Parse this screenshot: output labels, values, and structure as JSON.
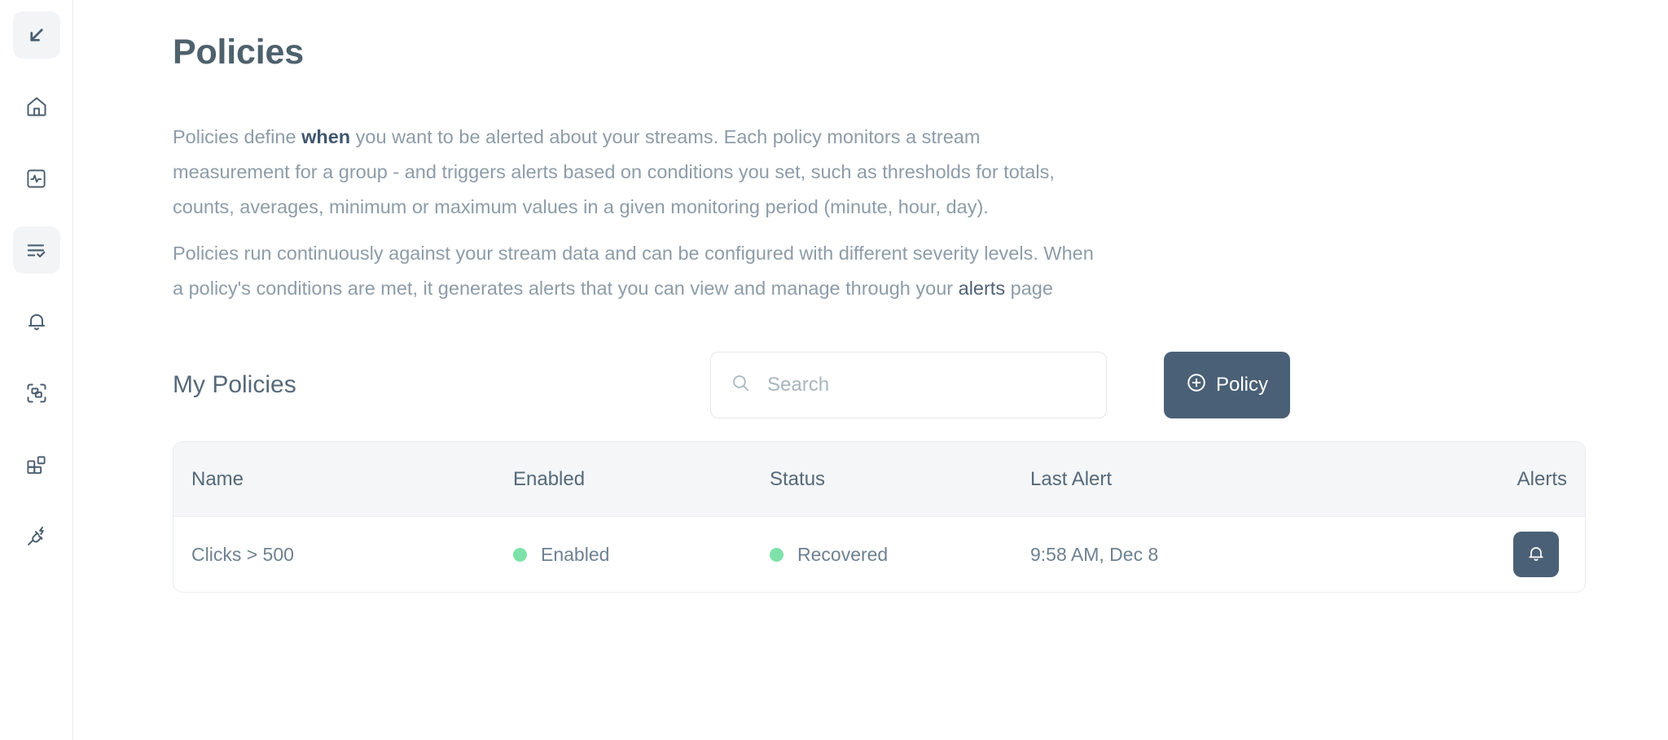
{
  "sidebar": {
    "items": [
      {
        "name": "collapse-sidebar",
        "icon": "collapse-arrow-icon",
        "active": true
      },
      {
        "name": "home",
        "icon": "home-icon",
        "active": false
      },
      {
        "name": "streams",
        "icon": "activity-pulse-icon",
        "active": false
      },
      {
        "name": "policies",
        "icon": "list-check-icon",
        "active": true
      },
      {
        "name": "alerts",
        "icon": "bell-icon",
        "active": false
      },
      {
        "name": "groups",
        "icon": "scan-group-icon",
        "active": false
      },
      {
        "name": "dashboards",
        "icon": "blocks-icon",
        "active": false
      },
      {
        "name": "integrations",
        "icon": "plug-zap-icon",
        "active": false
      }
    ]
  },
  "page": {
    "title": "Policies",
    "paragraph1_pre": "Policies define ",
    "paragraph1_strong": "when",
    "paragraph1_post": " you want to be alerted about your streams. Each policy monitors a stream measurement for a group - and triggers alerts based on conditions you set, such as thresholds for totals, counts, averages, minimum or maximum values in a given monitoring period (minute, hour, day).",
    "paragraph2_pre": "Policies run continuously against your stream data and can be configured with different severity levels. When a policy's conditions are met, it generates alerts that you can view and manage through your ",
    "paragraph2_link": "alerts",
    "paragraph2_post": " page"
  },
  "toolbar": {
    "section_title": "My Policies",
    "search_placeholder": "Search",
    "search_value": "",
    "search_icon": "search-icon",
    "add_policy_label": "Policy",
    "add_policy_icon": "plus-circle-icon"
  },
  "table": {
    "columns": [
      "Name",
      "Enabled",
      "Status",
      "Last Alert",
      "Alerts"
    ],
    "rows": [
      {
        "name": "Clicks > 500",
        "enabled": "Enabled",
        "status": "Recovered",
        "last_alert": "9:58 AM, Dec 8",
        "alerts_icon": "bell-icon"
      }
    ]
  },
  "colors": {
    "accent": "#4a6076",
    "status_green": "#7ee2a8",
    "text_dark": "#4e616d",
    "text_muted": "#8d9ca8",
    "header_bg": "#f4f6f7",
    "border": "#e9ecef"
  }
}
